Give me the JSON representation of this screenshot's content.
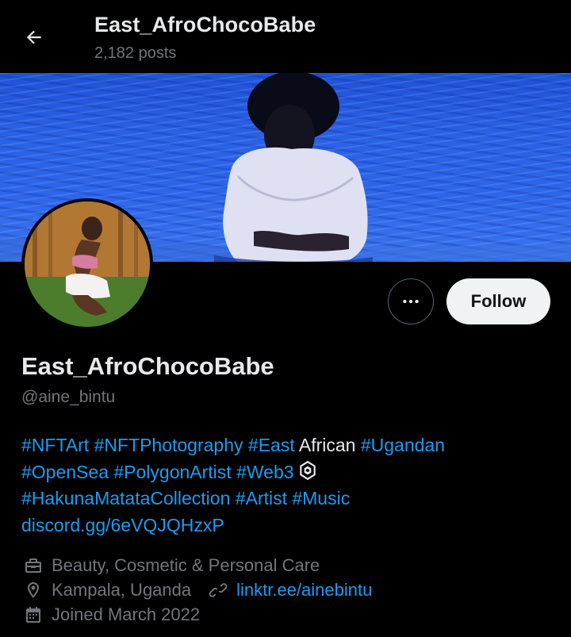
{
  "header": {
    "title": "East_AfroChocoBabe",
    "posts": "2,182 posts"
  },
  "icons": {
    "back": "arrow-left-icon",
    "more": "more-dots-icon",
    "category": "briefcase-icon",
    "location": "location-pin-icon",
    "link": "link-icon",
    "joined": "calendar-icon",
    "web3": "polygon-logo-icon"
  },
  "actions": {
    "follow_label": "Follow"
  },
  "profile": {
    "display_name": "East_AfroChocoBabe",
    "handle": "@aine_bintu"
  },
  "bio": {
    "line1": [
      {
        "text": "#NFTArt",
        "link": true
      },
      {
        "text": " ",
        "link": false
      },
      {
        "text": "#NFTPhotography",
        "link": true
      },
      {
        "text": " ",
        "link": false
      },
      {
        "text": "#East",
        "link": true
      },
      {
        "text": " African ",
        "link": false
      },
      {
        "text": "#Ugandan",
        "link": true
      }
    ],
    "line2": [
      {
        "text": "#OpenSea",
        "link": true
      },
      {
        "text": " ",
        "link": false
      },
      {
        "text": "#PolygonArtist",
        "link": true
      },
      {
        "text": " ",
        "link": false
      },
      {
        "text": "#Web3",
        "link": true
      }
    ],
    "line3": [
      {
        "text": "#HakunaMatataCollection",
        "link": true
      },
      {
        "text": " ",
        "link": false
      },
      {
        "text": "#Artist",
        "link": true
      },
      {
        "text": " ",
        "link": false
      },
      {
        "text": "#Music",
        "link": true
      }
    ],
    "line4": [
      {
        "text": "discord.gg/6eVQJQHzxP",
        "link": true
      }
    ]
  },
  "meta": {
    "category": "Beauty, Cosmetic & Personal Care",
    "location": "Kampala, Uganda",
    "website": "linktr.ee/ainebintu",
    "joined": "Joined March 2022"
  },
  "colors": {
    "background": "#000000",
    "accent": "#1d9bf0",
    "text_primary": "#e7e9ea",
    "text_secondary": "#71767b",
    "follow_bg": "#eff3f4"
  }
}
